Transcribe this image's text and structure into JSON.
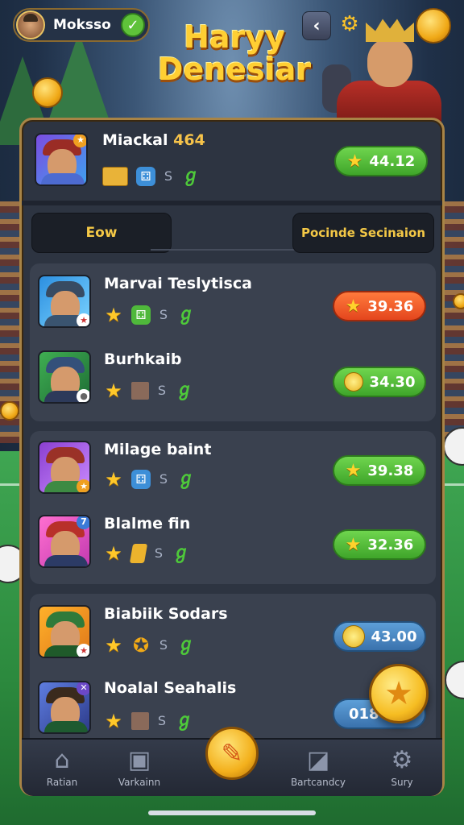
{
  "header": {
    "player_name": "Moksso",
    "title_line1": "Haryy",
    "title_line2": "Denesiar",
    "back_icon": "chevron-left-icon",
    "settings_icon": "gear-icon"
  },
  "top_card": {
    "name": "Miackal",
    "number": "464",
    "score": "44.12",
    "row_letter": "S"
  },
  "tabs": {
    "left": "Eow",
    "right": "Pocinde Secinaion"
  },
  "players": [
    {
      "name": "Marvai Teslytisca",
      "score": "39.36",
      "score_style": "orange",
      "score_icon": "star",
      "item": "dice-green",
      "letter": "S"
    },
    {
      "name": "Burhkaib",
      "score": "34.30",
      "score_style": "green",
      "score_icon": "coin",
      "item": "cube",
      "letter": "S"
    },
    {
      "name": "Milage baint",
      "score": "39.38",
      "score_style": "green",
      "score_icon": "star",
      "item": "dice-blue",
      "letter": "S"
    },
    {
      "name": "Blalme fin",
      "score": "32.36",
      "score_style": "green",
      "score_icon": "star",
      "item": "gold-bar",
      "letter": "S"
    },
    {
      "name": "Biabiik Sodars",
      "score": "43.00",
      "score_style": "blue",
      "score_icon": "medal",
      "item": "medal",
      "letter": "S"
    },
    {
      "name": "Noalal Seahalis",
      "score": "018",
      "score_style": "blue",
      "score_icon": "none",
      "item": "cube",
      "letter": "S"
    }
  ],
  "nav": {
    "items": [
      {
        "label": "Ratian",
        "icon": "home-icon"
      },
      {
        "label": "Varkainn",
        "icon": "chest-icon"
      },
      {
        "label": "Bartcandcy",
        "icon": "board-icon"
      },
      {
        "label": "Sury",
        "icon": "gear-icon"
      }
    ],
    "center_icon": "whistle-icon"
  },
  "colors": {
    "panel": "#2d3441",
    "accent_gold": "#f4c846",
    "green_score": "#4fb83b",
    "orange_score": "#e4461d",
    "blue_score": "#3a72ad"
  }
}
